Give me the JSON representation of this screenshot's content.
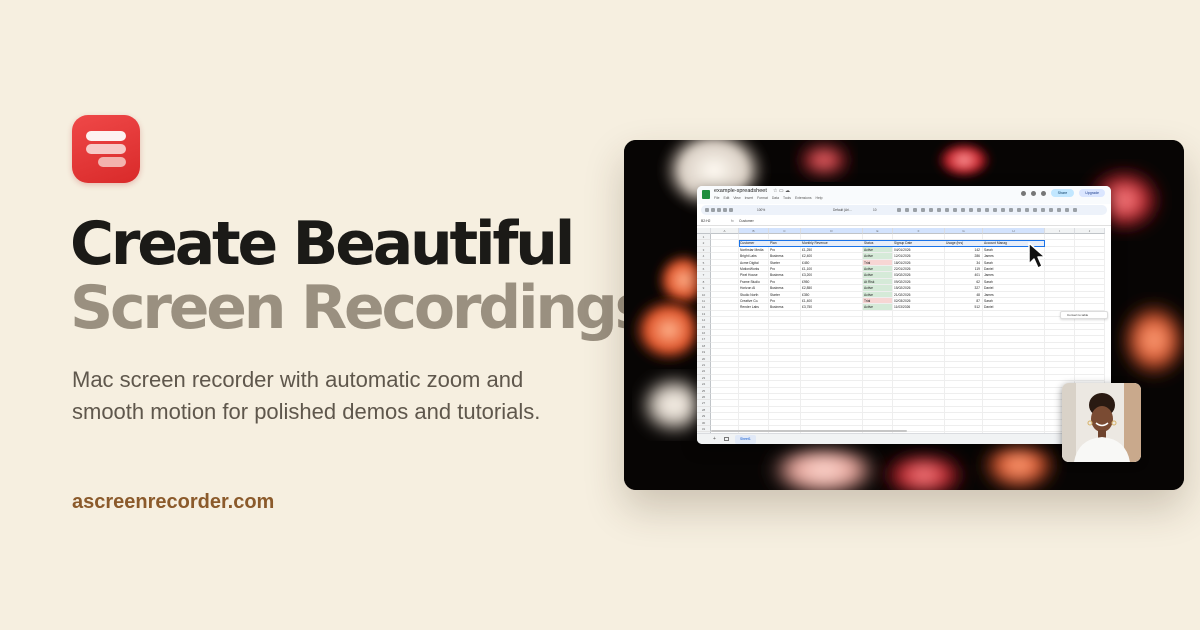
{
  "hero": {
    "headline_line1": "Create Beautiful",
    "headline_line2": "Screen Recordings",
    "subcopy": "Mac screen recorder with automatic zoom and smooth motion for polished demos and tutorials.",
    "site": "ascreenrecorder.com"
  },
  "colors": {
    "background": "#f6efe0",
    "brand_red": "#e23c3c",
    "headline_dark": "#1b1a17",
    "headline_muted": "#9a9080",
    "link_brown": "#8b5a2b"
  },
  "spreadsheet": {
    "title": "example-spreadsheet",
    "menu": [
      "File",
      "Edit",
      "View",
      "Insert",
      "Format",
      "Data",
      "Tools",
      "Extensions",
      "Help"
    ],
    "share_label": "Share",
    "upgrade_label": "Upgrade",
    "zoom": "100%",
    "font": "Default (Ari...",
    "font_size": "10",
    "cell_ref": "B2:H2",
    "formula_value": "Customer",
    "column_letters": [
      "A",
      "B",
      "C",
      "D",
      "E",
      "F",
      "G",
      "H",
      "I",
      "J"
    ],
    "headers": [
      "Customer",
      "Plan",
      "Monthly Revenue",
      "Status",
      "Signup Date",
      "Usage (hrs)",
      "Account Manag"
    ],
    "rows": [
      [
        "Northstar Media",
        "Pro",
        "£1,250",
        "Active",
        "04/01/2026",
        "142",
        "Sarah"
      ],
      [
        "Bright Labs",
        "Business",
        "£2,400",
        "Active",
        "12/01/2026",
        "286",
        "James"
      ],
      [
        "Acme Digital",
        "Starter",
        "£450",
        "Trial",
        "18/01/2026",
        "34",
        "Sarah"
      ],
      [
        "MotionWorks",
        "Pro",
        "£1,100",
        "Active",
        "22/01/2026",
        "119",
        "Daniel"
      ],
      [
        "Pixel House",
        "Business",
        "£3,200",
        "Active",
        "03/02/2026",
        "401",
        "James"
      ],
      [
        "Frame Studio",
        "Pro",
        "£950",
        "At Risk",
        "09/02/2026",
        "62",
        "Sarah"
      ],
      [
        "Horizon AI",
        "Business",
        "£2,850",
        "Active",
        "15/02/2026",
        "327",
        "Daniel"
      ],
      [
        "Studio North",
        "Starter",
        "£350",
        "Active",
        "21/02/2026",
        "48",
        "James"
      ],
      [
        "Creative Co.",
        "Pro",
        "£1,400",
        "Trial",
        "02/03/2026",
        "87",
        "Sarah"
      ],
      [
        "Render Labs",
        "Business",
        "£3,750",
        "Active",
        "11/03/2026",
        "512",
        "Daniel"
      ]
    ],
    "row_count": 32,
    "convert_label": "Convert to table",
    "sheet_tab": "Sheet1"
  }
}
